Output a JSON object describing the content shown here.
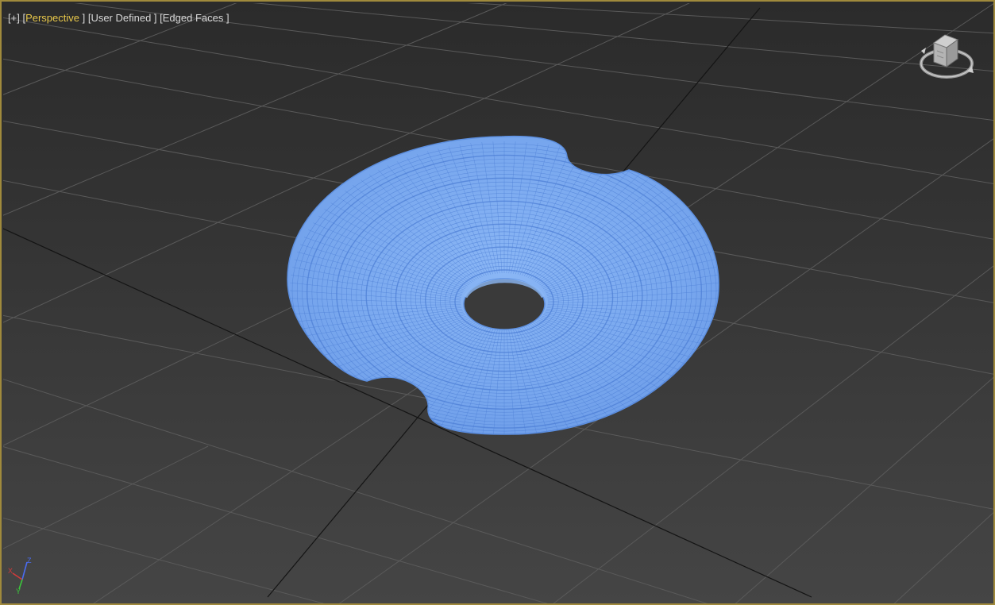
{
  "viewport": {
    "labels": {
      "plus": "[+]",
      "view": "Perspective",
      "shading_mode": "User Defined",
      "display_mode": "Edged Faces"
    },
    "active_label_color": "#e8c84a",
    "border_color": "#a08a3c",
    "mesh_color": "#7aa9f0",
    "mesh_wire_color": "#4d7fd6"
  },
  "viewcube": {
    "icon": "viewcube-icon",
    "compass_icon": "compass-ring-icon"
  },
  "axis_tripod": {
    "x": "X",
    "y": "Y",
    "z": "Z",
    "colors": {
      "x": "#d23b3b",
      "y": "#3bc83b",
      "z": "#4a6cf0"
    }
  },
  "scene": {
    "object": "torus-knot-mesh",
    "grid": "home-grid"
  }
}
